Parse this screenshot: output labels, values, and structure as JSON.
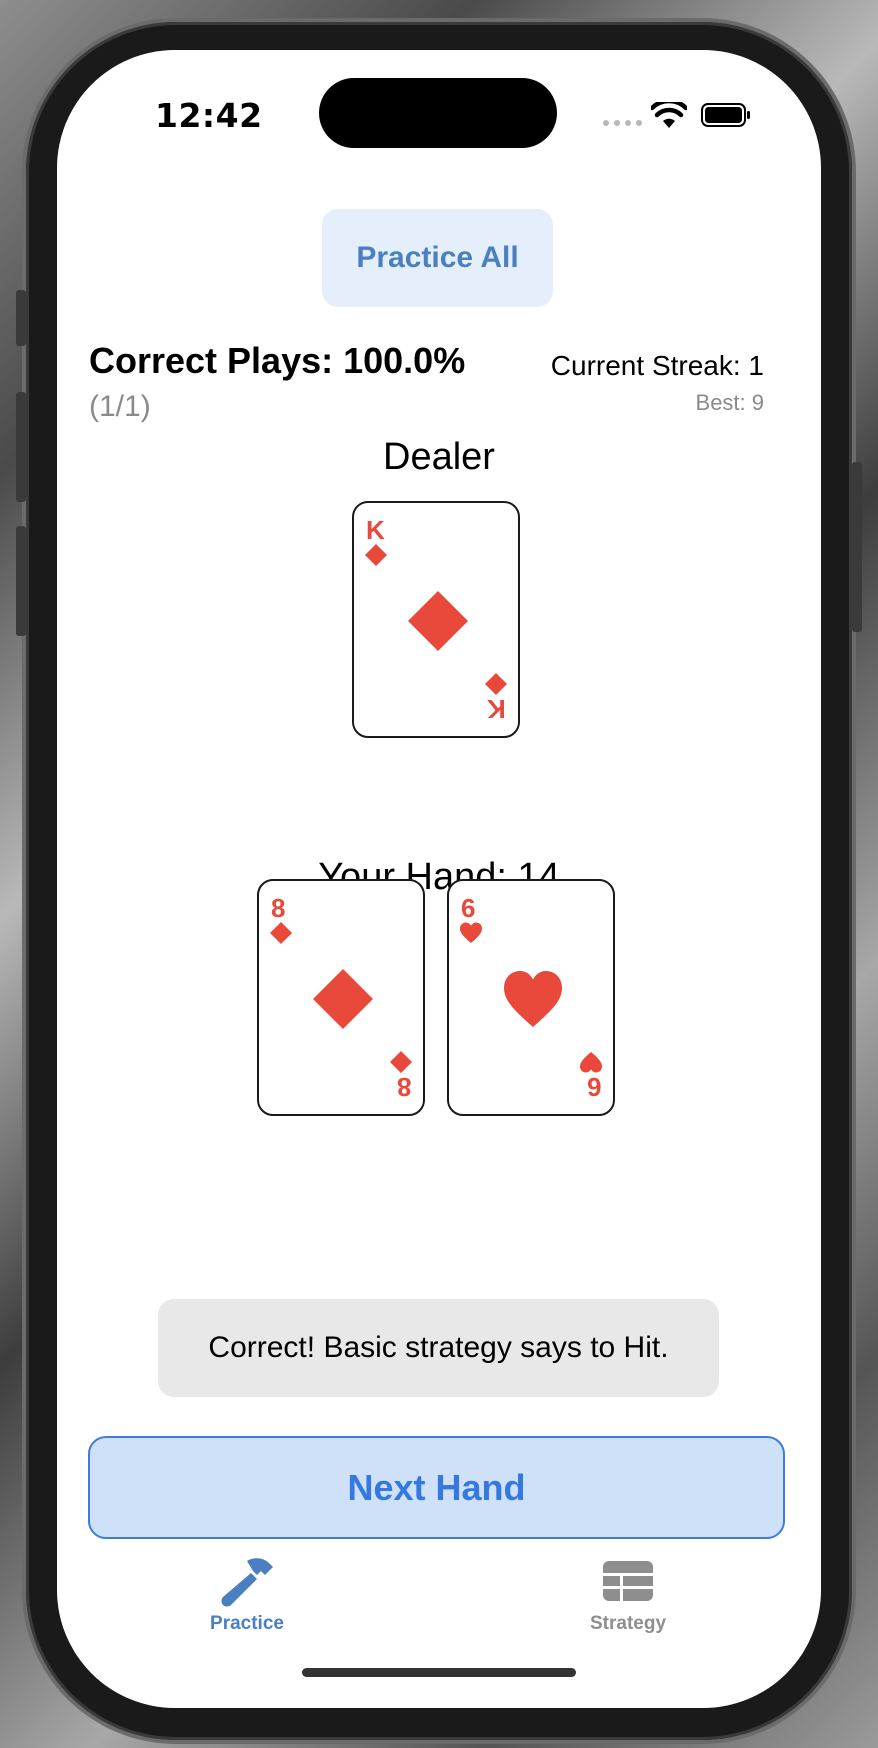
{
  "status_bar": {
    "time": "12:42"
  },
  "header": {
    "practice_all_label": "Practice All"
  },
  "stats": {
    "correct_plays": "Correct Plays: 100.0%",
    "correct_count": "(1/1)",
    "current_streak": "Current Streak: 1",
    "best": "Best: 9"
  },
  "dealer": {
    "label": "Dealer",
    "card": {
      "rank": "K",
      "suit": "diamonds"
    }
  },
  "player": {
    "label": "Your Hand: 14",
    "cards": [
      {
        "rank": "8",
        "suit": "diamonds"
      },
      {
        "rank": "6",
        "suit": "hearts"
      }
    ]
  },
  "feedback": {
    "message": "Correct! Basic strategy says to Hit."
  },
  "actions": {
    "next_hand_label": "Next Hand"
  },
  "tabs": [
    {
      "label": "Practice",
      "icon": "hammer-icon",
      "active": true
    },
    {
      "label": "Strategy",
      "icon": "table-grid-icon",
      "active": false
    }
  ],
  "colors": {
    "accent": "#4a7fc1",
    "button_blue": "#3478e0",
    "card_red": "#e8493b",
    "feedback_bg": "#e8e8e8"
  }
}
